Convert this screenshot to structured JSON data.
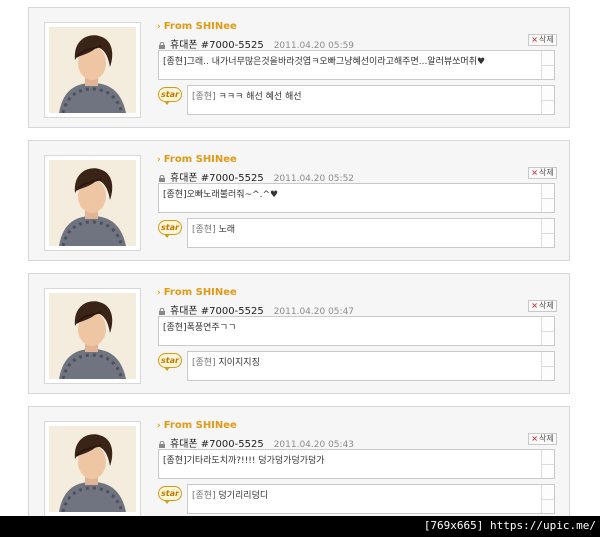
{
  "threads": [
    {
      "from": "From SHINee",
      "name": "휴대폰",
      "number": "#7000-5525",
      "time": "2011.04.20 05:59",
      "delete_label": "삭제",
      "message": "[종현]그래.. 내가너무많은것을바라것엽ㅋ오빠그냥혜선이라고해주면...알러뷰쏘머취♥",
      "star": "star",
      "reply_tag": "[종현]",
      "reply": "ㅋㅋㅋ 해선 혜선 해선"
    },
    {
      "from": "From SHINee",
      "name": "휴대폰",
      "number": "#7000-5525",
      "time": "2011.04.20 05:52",
      "delete_label": "삭제",
      "message": "[종현]오빠노래불러줘~^.^♥",
      "star": "star",
      "reply_tag": "[종현]",
      "reply": "노래"
    },
    {
      "from": "From SHINee",
      "name": "휴대폰",
      "number": "#7000-5525",
      "time": "2011.04.20 05:47",
      "delete_label": "삭제",
      "message": "[종현]폭풍연주ㄱㄱ",
      "star": "star",
      "reply_tag": "[종현]",
      "reply": "지이지지징"
    },
    {
      "from": "From SHINee",
      "name": "휴대폰",
      "number": "#7000-5525",
      "time": "2011.04.20 05:43",
      "delete_label": "삭제",
      "message": "[종현]기타라도치까?!!!! 덩가덩가덩가덩가",
      "star": "star",
      "reply_tag": "[종현]",
      "reply": "덩기리리덩디"
    }
  ],
  "watermark": "[769x665] https://upic.me/"
}
